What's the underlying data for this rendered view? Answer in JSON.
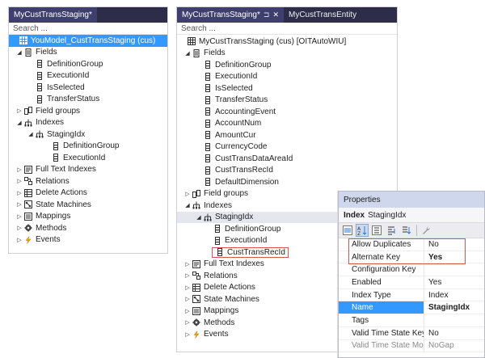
{
  "left": {
    "tab_title": "MyCustTransStaging*",
    "search_placeholder": "Search ...",
    "root_label": "YouModel_CustTransStaging (cus)",
    "fields_label": "Fields",
    "fields": [
      "DefinitionGroup",
      "ExecutionId",
      "IsSelected",
      "TransferStatus"
    ],
    "field_groups_label": "Field groups",
    "indexes_label": "Indexes",
    "index_name": "StagingIdx",
    "index_fields": [
      "DefinitionGroup",
      "ExecutionId"
    ],
    "other_nodes": [
      "Full Text Indexes",
      "Relations",
      "Delete Actions",
      "State Machines",
      "Mappings",
      "Methods",
      "Events"
    ]
  },
  "right": {
    "tabs": [
      {
        "label": "MyCustTransStaging*",
        "active": true
      },
      {
        "label": "MyCustTransEntity",
        "active": false
      }
    ],
    "search_placeholder": "Search ...",
    "root_label": "MyCustTransStaging (cus) [OITAutoWIU]",
    "fields_label": "Fields",
    "fields": [
      "DefinitionGroup",
      "ExecutionId",
      "IsSelected",
      "TransferStatus",
      "AccountingEvent",
      "AccountNum",
      "AmountCur",
      "CurrencyCode",
      "CustTransDataAreaId",
      "CustTransRecId",
      "DefaultDimension"
    ],
    "field_groups_label": "Field groups",
    "indexes_label": "Indexes",
    "index_name": "StagingIdx",
    "index_fields": [
      "DefinitionGroup",
      "ExecutionId",
      "CustTransRecId"
    ],
    "other_nodes": [
      "Full Text Indexes",
      "Relations",
      "Delete Actions",
      "State Machines",
      "Mappings",
      "Methods",
      "Events"
    ]
  },
  "properties": {
    "title": "Properties",
    "object_type": "Index",
    "object_name": "StagingIdx",
    "rows": [
      {
        "name": "Allow Duplicates",
        "value": "No"
      },
      {
        "name": "Alternate Key",
        "value": "Yes"
      },
      {
        "name": "Configuration Key",
        "value": ""
      },
      {
        "name": "Enabled",
        "value": "Yes"
      },
      {
        "name": "Index Type",
        "value": "Index"
      },
      {
        "name": "Name",
        "value": "StagingIdx"
      },
      {
        "name": "Tags",
        "value": ""
      },
      {
        "name": "Valid Time State Key",
        "value": "No"
      },
      {
        "name": "Valid Time State Mode",
        "value": "NoGap"
      }
    ]
  },
  "colors": {
    "tab_bar": "#2d2d4a",
    "selection": "#3399ff",
    "highlight_box": "#d9534f",
    "properties_header": "#cfd7ec"
  }
}
